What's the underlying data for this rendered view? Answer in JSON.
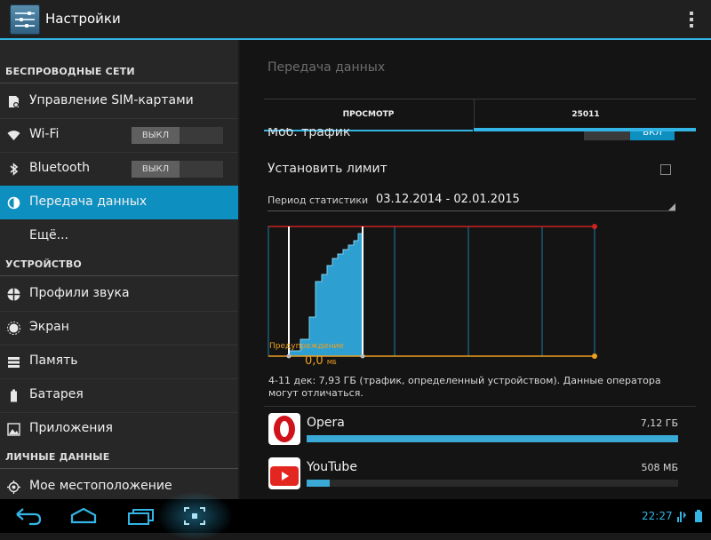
{
  "actionbar": {
    "title": "Настройки",
    "app_icon": "settings-icon",
    "overflow_icon": "overflow-menu-icon"
  },
  "sidebar": {
    "sections": [
      {
        "header": "БЕСПРОВОДНЫЕ СЕТИ"
      },
      {
        "header": "УСТРОЙСТВО"
      },
      {
        "header": "ЛИЧНЫЕ ДАННЫЕ"
      }
    ],
    "items": [
      {
        "label": "Управление SIM-картами",
        "icon": "sim-settings-icon"
      },
      {
        "label": "Wi-Fi",
        "icon": "wifi-icon",
        "toggle": "ВЫКЛ"
      },
      {
        "label": "Bluetooth",
        "icon": "bluetooth-icon",
        "toggle": "ВЫКЛ"
      },
      {
        "label": "Передача данных",
        "icon": "data-usage-icon",
        "selected": true
      },
      {
        "label": "Ещё..."
      },
      {
        "label": "Профили звука",
        "icon": "sound-profile-icon"
      },
      {
        "label": "Экран",
        "icon": "display-icon"
      },
      {
        "label": "Память",
        "icon": "storage-icon"
      },
      {
        "label": "Батарея",
        "icon": "battery-icon"
      },
      {
        "label": "Приложения",
        "icon": "apps-icon"
      },
      {
        "label": "Мое местоположение",
        "icon": "location-icon"
      }
    ]
  },
  "main": {
    "title": "Передача данных",
    "tabs": [
      {
        "label": "ПРОСМОТР"
      },
      {
        "label": "25011"
      }
    ],
    "mobile_traffic": {
      "label": "Моб. трафик",
      "toggle": "ВКЛ"
    },
    "set_limit": {
      "label": "Установить лимит",
      "checked": false
    },
    "period": {
      "label": "Период статистики",
      "value": "03.12.2014 - 02.01.2015"
    },
    "warning": {
      "label": "Предупреждение",
      "value": "0,0",
      "unit": "МБ"
    },
    "note": "4-11 дек: 7,93 ГБ (трафик, определенный устройством). Данные оператора могут отличаться.",
    "apps": [
      {
        "name": "Opera",
        "size": "7,12 ГБ",
        "icon": "opera-icon",
        "usage_fraction": 1.0
      },
      {
        "name": "YouTube",
        "size": "508 МБ",
        "icon": "youtube-icon",
        "usage_fraction": 0.0625
      }
    ]
  },
  "colors": {
    "accent": "#33b5e5",
    "selected": "#0d8fc0",
    "limit": "#cc2222",
    "warning": "#f0a020"
  },
  "statusbar": {
    "time": "22:27",
    "icons": [
      "back-icon",
      "home-icon",
      "recent-apps-icon",
      "screenshot-icon",
      "signal-icon",
      "battery-status-icon"
    ]
  }
}
